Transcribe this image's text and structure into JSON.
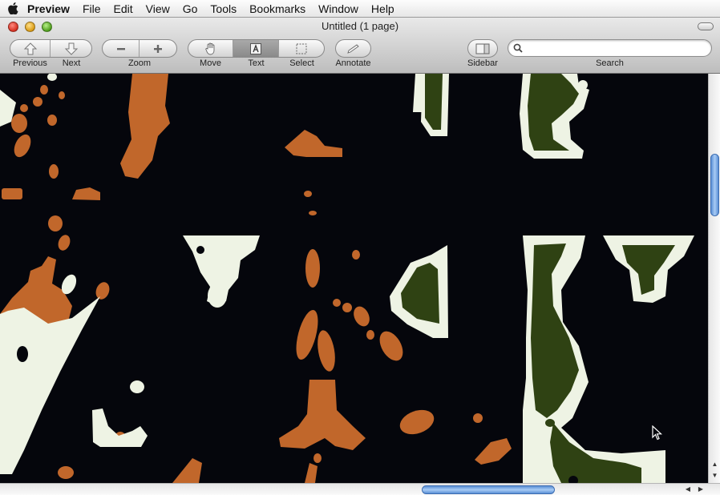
{
  "menubar": {
    "apple_icon": "apple-logo-icon",
    "app_name": "Preview",
    "items": [
      "File",
      "Edit",
      "View",
      "Go",
      "Tools",
      "Bookmarks",
      "Window",
      "Help"
    ]
  },
  "window": {
    "title": "Untitled (1 page)"
  },
  "toolbar": {
    "previous_label": "Previous",
    "next_label": "Next",
    "zoom_label": "Zoom",
    "move_label": "Move",
    "text_label": "Text",
    "select_label": "Select",
    "annotate_label": "Annotate",
    "sidebar_label": "Sidebar",
    "search_label": "Search",
    "active_tool": "Text"
  },
  "search": {
    "value": "",
    "placeholder": ""
  },
  "colors": {
    "background": "#05060c",
    "orange": "#c1672b",
    "cream": "#eef3e4",
    "olive": "#2f4213",
    "scroll_accent": "#5a8fd6"
  },
  "scroll": {
    "vertical_position_percent": 20,
    "horizontal_position_percent": 60
  }
}
